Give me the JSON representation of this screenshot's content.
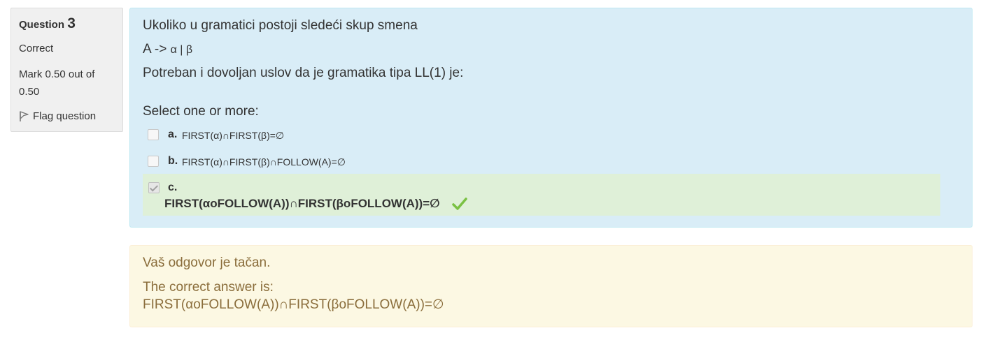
{
  "info": {
    "question_label": "Question",
    "question_number": "3",
    "state": "Correct",
    "grade": "Mark 0.50 out of 0.50",
    "flag_label": "Flag question"
  },
  "question": {
    "line1": "Ukoliko u gramatici postoji sledeći skup smena",
    "rule_lhs": "A ->",
    "rule_rhs": "α | β",
    "line3": "Potreban i dovoljan uslov da je gramatika tipa LL(1) je:",
    "prompt": "Select one or more:",
    "options": [
      {
        "letter": "a.",
        "text": "FIRST(α)∩FIRST(β)=∅",
        "checked": false,
        "correct": false
      },
      {
        "letter": "b.",
        "text": "FIRST(α)∩FIRST(β)∩FOLLOW(A)=∅",
        "checked": false,
        "correct": false
      },
      {
        "letter": "c.",
        "text": "FIRST(αoFOLLOW(A))∩FIRST(βoFOLLOW(A))=∅",
        "checked": true,
        "correct": true
      }
    ]
  },
  "outcome": {
    "feedback": "Vaš odgovor je tačan.",
    "right_answer_label": "The correct answer is:",
    "right_answer": "FIRST(αoFOLLOW(A))∩FIRST(βoFOLLOW(A))=∅"
  },
  "colors": {
    "formulation_bg": "#d9edf7",
    "correct_bg": "#dff0d8",
    "outcome_bg": "#fcf8e3",
    "outcome_text": "#8a6d3b",
    "check_green": "#7ac143"
  }
}
